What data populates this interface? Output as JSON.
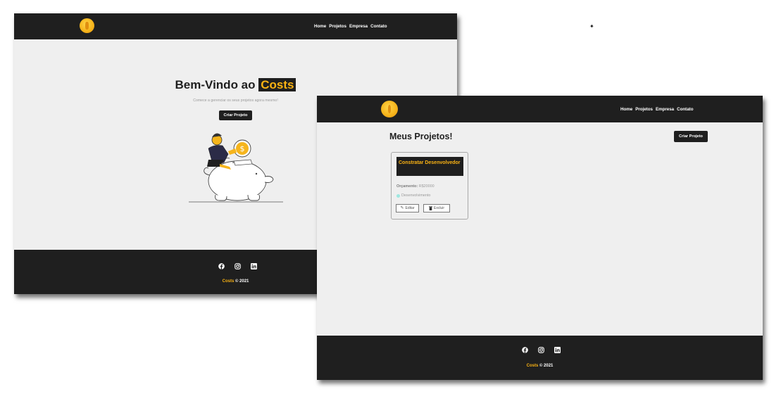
{
  "nav": {
    "items": [
      "Home",
      "Projetos",
      "Empresa",
      "Contato"
    ]
  },
  "home": {
    "hero_title_prefix": "Bem-Vindo ao ",
    "hero_title_brand": "Costs",
    "hero_subtitle": "Comece a gerenciar os seus projetos agora mesmo!",
    "cta_label": "Criar Projeto"
  },
  "projects": {
    "page_title": "Meus Projetos!",
    "create_label": "Criar Projeto",
    "card": {
      "title": "Constratar Desenvolvedor",
      "budget_label": "Orçamento:",
      "budget_value": "R$20000",
      "category": "Desenvolvimento",
      "category_color": "#9ee7e0",
      "edit_label": "Editar",
      "delete_label": "Excluir"
    }
  },
  "footer": {
    "icons": [
      "facebook-icon",
      "instagram-icon",
      "linkedin-icon"
    ],
    "brand": "Costs",
    "copyright_suffix": " © 2021"
  },
  "decor": {
    "sparkle": "✦"
  },
  "colors": {
    "accent": "#fbb313",
    "dark": "#1f1f1f",
    "page_bg": "#efefef"
  }
}
